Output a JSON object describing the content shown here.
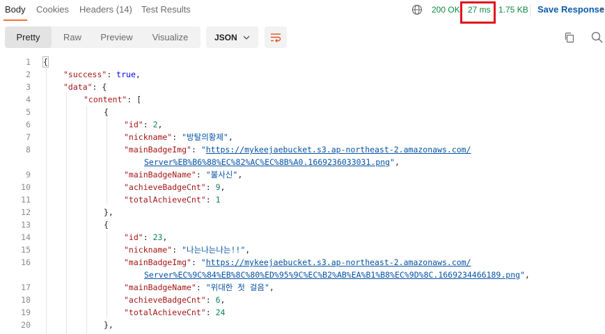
{
  "tabs": [
    {
      "label": "Body"
    },
    {
      "label": "Cookies"
    },
    {
      "label": "Headers (14)"
    },
    {
      "label": "Test Results"
    }
  ],
  "response": {
    "status": "200 OK",
    "time": "27 ms",
    "size": "1.75 KB",
    "save_label": "Save Response"
  },
  "view_modes": [
    "Pretty",
    "Raw",
    "Preview",
    "Visualize"
  ],
  "format": {
    "selected": "JSON"
  },
  "colors": {
    "accent": "#ff6c37",
    "status": "#0a8a3f",
    "highlight": "#e0101a",
    "link": "#0b5cad"
  },
  "code": {
    "line_numbers": [
      "1",
      "2",
      "3",
      "4",
      "5",
      "6",
      "7",
      "8",
      "",
      "9",
      "10",
      "11",
      "12",
      "13",
      "14",
      "15",
      "16",
      "",
      "17",
      "18",
      "19",
      "20"
    ],
    "lines": [
      [
        {
          "t": "p",
          "v": "{"
        }
      ],
      [
        {
          "t": "k",
          "v": "\"success\""
        },
        {
          "t": "p",
          "v": ": "
        },
        {
          "t": "b",
          "v": "true"
        },
        {
          "t": "p",
          "v": ","
        }
      ],
      [
        {
          "t": "k",
          "v": "\"data\""
        },
        {
          "t": "p",
          "v": ": {"
        }
      ],
      [
        {
          "t": "k",
          "v": "\"content\""
        },
        {
          "t": "p",
          "v": ": ["
        }
      ],
      [
        {
          "t": "p",
          "v": "{"
        }
      ],
      [
        {
          "t": "k",
          "v": "\"id\""
        },
        {
          "t": "p",
          "v": ": "
        },
        {
          "t": "n",
          "v": "2"
        },
        {
          "t": "p",
          "v": ","
        }
      ],
      [
        {
          "t": "k",
          "v": "\"nickname\""
        },
        {
          "t": "p",
          "v": ": "
        },
        {
          "t": "s",
          "v": "\"방탈의황제\""
        },
        {
          "t": "p",
          "v": ","
        }
      ],
      [
        {
          "t": "k",
          "v": "\"mainBadgeImg\""
        },
        {
          "t": "p",
          "v": ": "
        },
        {
          "t": "s",
          "v": "\""
        },
        {
          "t": "u",
          "v": "https://mykeejaebucket.s3.ap-northeast-2.amazonaws.com/"
        }
      ],
      [
        {
          "t": "u",
          "v": "Server%EB%B6%88%EC%82%AC%EC%8B%A0.1669236033031.png"
        },
        {
          "t": "s",
          "v": "\""
        },
        {
          "t": "p",
          "v": ","
        }
      ],
      [
        {
          "t": "k",
          "v": "\"mainBadgeName\""
        },
        {
          "t": "p",
          "v": ": "
        },
        {
          "t": "s",
          "v": "\"불사신\""
        },
        {
          "t": "p",
          "v": ","
        }
      ],
      [
        {
          "t": "k",
          "v": "\"achieveBadgeCnt\""
        },
        {
          "t": "p",
          "v": ": "
        },
        {
          "t": "n",
          "v": "9"
        },
        {
          "t": "p",
          "v": ","
        }
      ],
      [
        {
          "t": "k",
          "v": "\"totalAchieveCnt\""
        },
        {
          "t": "p",
          "v": ": "
        },
        {
          "t": "n",
          "v": "1"
        }
      ],
      [
        {
          "t": "p",
          "v": "},"
        }
      ],
      [
        {
          "t": "p",
          "v": "{"
        }
      ],
      [
        {
          "t": "k",
          "v": "\"id\""
        },
        {
          "t": "p",
          "v": ": "
        },
        {
          "t": "n",
          "v": "23"
        },
        {
          "t": "p",
          "v": ","
        }
      ],
      [
        {
          "t": "k",
          "v": "\"nickname\""
        },
        {
          "t": "p",
          "v": ": "
        },
        {
          "t": "s",
          "v": "\"나는나는나는!!\""
        },
        {
          "t": "p",
          "v": ","
        }
      ],
      [
        {
          "t": "k",
          "v": "\"mainBadgeImg\""
        },
        {
          "t": "p",
          "v": ": "
        },
        {
          "t": "s",
          "v": "\""
        },
        {
          "t": "u",
          "v": "https://mykeejaebucket.s3.ap-northeast-2.amazonaws.com/"
        }
      ],
      [
        {
          "t": "u",
          "v": "Server%EC%9C%84%EB%8C%80%ED%95%9C%EC%B2%AB%EA%B1%B8%EC%9D%8C.1669234466189.png"
        },
        {
          "t": "s",
          "v": "\""
        },
        {
          "t": "p",
          "v": ","
        }
      ],
      [
        {
          "t": "k",
          "v": "\"mainBadgeName\""
        },
        {
          "t": "p",
          "v": ": "
        },
        {
          "t": "s",
          "v": "\"위대한 첫 걸음\""
        },
        {
          "t": "p",
          "v": ","
        }
      ],
      [
        {
          "t": "k",
          "v": "\"achieveBadgeCnt\""
        },
        {
          "t": "p",
          "v": ": "
        },
        {
          "t": "n",
          "v": "6"
        },
        {
          "t": "p",
          "v": ","
        }
      ],
      [
        {
          "t": "k",
          "v": "\"totalAchieveCnt\""
        },
        {
          "t": "p",
          "v": ": "
        },
        {
          "t": "n",
          "v": "24"
        }
      ],
      [
        {
          "t": "p",
          "v": "},"
        }
      ]
    ]
  }
}
